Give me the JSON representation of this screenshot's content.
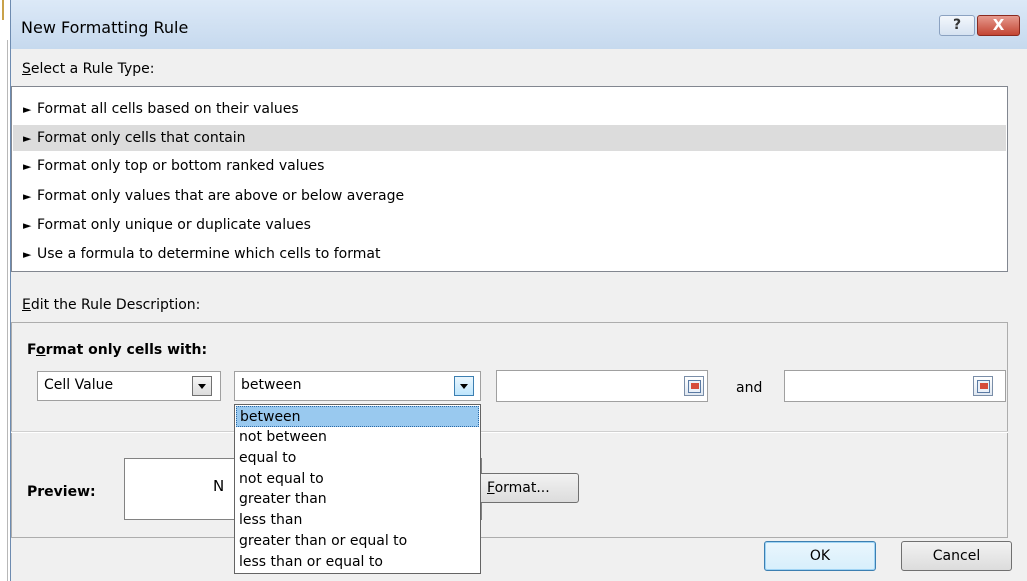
{
  "dialog": {
    "title": "New Formatting Rule",
    "help_glyph": "?",
    "close_glyph": "X"
  },
  "rule_type": {
    "label_accel": "S",
    "label_rest": "elect a Rule Type:",
    "arrow_glyph": "►",
    "items": [
      {
        "label": "Format all cells based on their values"
      },
      {
        "label": "Format only cells that contain",
        "selected": true
      },
      {
        "label": "Format only top or bottom ranked values"
      },
      {
        "label": "Format only values that are above or below average"
      },
      {
        "label": "Format only unique or duplicate values"
      },
      {
        "label": "Use a formula to determine which cells to format"
      }
    ]
  },
  "description": {
    "label_accel": "E",
    "label_rest": "dit the Rule Description:",
    "format_with_pre": "F",
    "format_with_accel": "o",
    "format_with_rest": "rmat only cells with:",
    "cell_value_combo": "Cell Value",
    "operator_combo": "between",
    "value1": "",
    "and_label": "and",
    "value2": "",
    "preview_label": "Preview:",
    "preview_text": "N",
    "format_button_accel": "F",
    "format_button_rest": "ormat..."
  },
  "operator_options": [
    {
      "label": "between",
      "selected": true
    },
    {
      "label": "not between"
    },
    {
      "label": "equal to"
    },
    {
      "label": "not equal to"
    },
    {
      "label": "greater than"
    },
    {
      "label": "less than"
    },
    {
      "label": "greater than or equal to"
    },
    {
      "label": "less than or equal to"
    }
  ],
  "buttons": {
    "ok": "OK",
    "cancel": "Cancel"
  },
  "colors": {
    "selection_highlight": "#99c9ef",
    "selected_rule_row": "#dcdcdc",
    "close_button": "#c34533"
  }
}
